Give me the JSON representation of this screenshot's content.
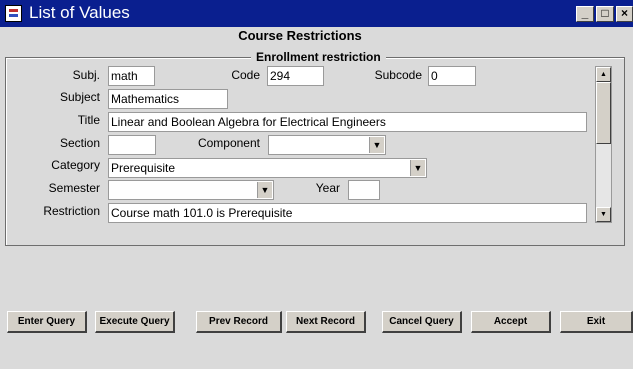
{
  "window": {
    "title": "List of Values",
    "controls": [
      "_",
      "□",
      "×"
    ]
  },
  "section_title": "Course Restrictions",
  "group_title": "Enrollment restriction",
  "fields": {
    "subj": {
      "label": "Subj.",
      "value": "math"
    },
    "code": {
      "label": "Code",
      "value": "294"
    },
    "subcode": {
      "label": "Subcode",
      "value": "0"
    },
    "subject": {
      "label": "Subject",
      "value": "Mathematics"
    },
    "title": {
      "label": "Title",
      "value": "Linear and Boolean Algebra for Electrical Engineers"
    },
    "section": {
      "label": "Section",
      "value": ""
    },
    "component": {
      "label": "Component",
      "value": ""
    },
    "category": {
      "label": "Category",
      "value": "Prerequisite"
    },
    "semester": {
      "label": "Semester",
      "value": ""
    },
    "year": {
      "label": "Year",
      "value": ""
    },
    "restriction": {
      "label": "Restriction",
      "value": "Course math 101.0 is Prerequisite"
    }
  },
  "scrollbar": {
    "up": "▲",
    "down": "▼"
  },
  "dropdown_arrow": "▼",
  "buttons": {
    "enter_query": "Enter Query",
    "execute_query": "Execute Query",
    "prev_record": "Prev Record",
    "next_record": "Next Record",
    "cancel_query": "Cancel Query",
    "accept": "Accept",
    "exit": "Exit"
  },
  "colors": {
    "titlebar": "#0a1f8f",
    "background": "#dadada"
  }
}
